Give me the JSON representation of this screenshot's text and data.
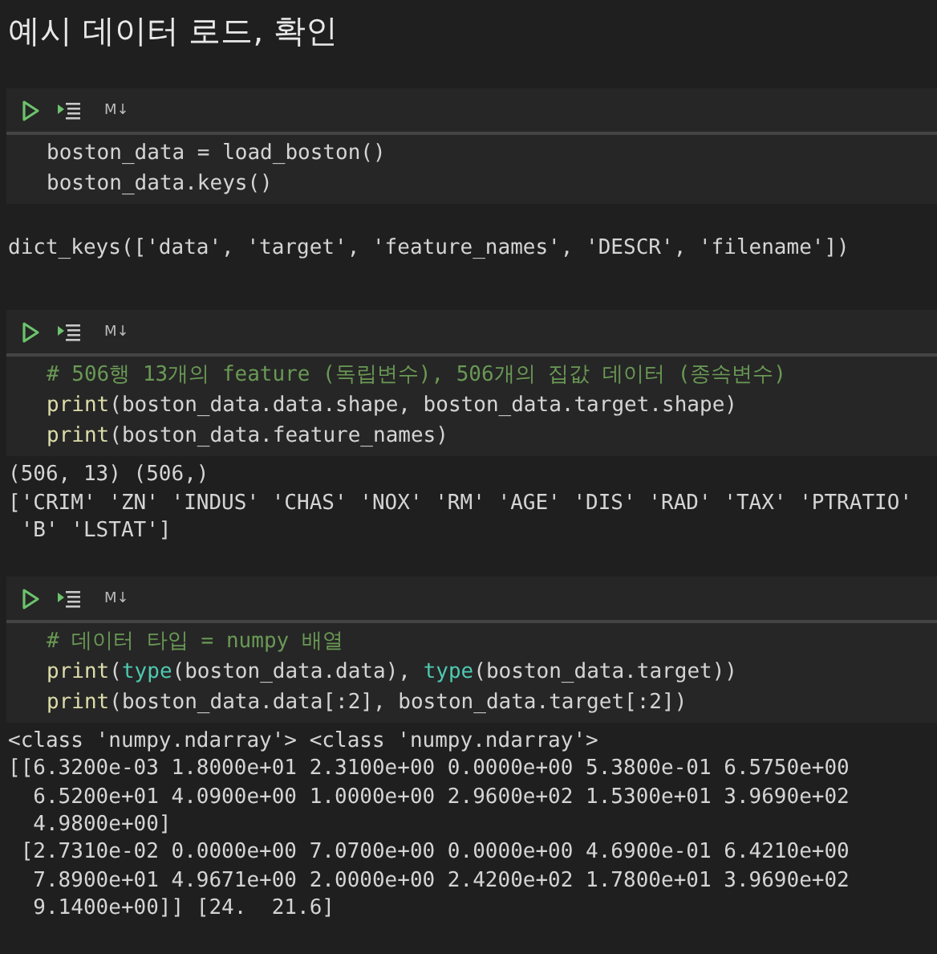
{
  "title": "예시 데이터 로드, 확인",
  "cells": [
    {
      "markdown_label": "M↓",
      "code": [
        [
          {
            "kind": "plain",
            "text": "boston_data = load_boston()"
          }
        ],
        [
          {
            "kind": "plain",
            "text": "boston_data.keys()"
          }
        ]
      ],
      "output": [
        "dict_keys(['data', 'target', 'feature_names', 'DESCR', 'filename'])"
      ]
    },
    {
      "markdown_label": "M↓",
      "code": [
        [
          {
            "kind": "comment",
            "text": "# 506행 13개의 feature (독립변수), 506개의 집값 데이터 (종속변수)"
          }
        ],
        [
          {
            "kind": "function",
            "text": "print"
          },
          {
            "kind": "plain",
            "text": "(boston_data.data.shape, boston_data.target.shape)"
          }
        ],
        [
          {
            "kind": "function",
            "text": "print"
          },
          {
            "kind": "plain",
            "text": "(boston_data.feature_names)"
          }
        ]
      ],
      "output": [
        "(506, 13) (506,)",
        "['CRIM' 'ZN' 'INDUS' 'CHAS' 'NOX' 'RM' 'AGE' 'DIS' 'RAD' 'TAX' 'PTRATIO'",
        " 'B' 'LSTAT']"
      ]
    },
    {
      "markdown_label": "M↓",
      "code": [
        [
          {
            "kind": "comment",
            "text": "# 데이터 타입 = numpy 배열"
          }
        ],
        [
          {
            "kind": "function",
            "text": "print"
          },
          {
            "kind": "plain",
            "text": "("
          },
          {
            "kind": "type",
            "text": "type"
          },
          {
            "kind": "plain",
            "text": "(boston_data.data), "
          },
          {
            "kind": "type",
            "text": "type"
          },
          {
            "kind": "plain",
            "text": "(boston_data.target))"
          }
        ],
        [
          {
            "kind": "function",
            "text": "print"
          },
          {
            "kind": "plain",
            "text": "(boston_data.data[:2], boston_data.target[:2])"
          }
        ]
      ],
      "output": [
        "<class 'numpy.ndarray'> <class 'numpy.ndarray'>",
        "[[6.3200e-03 1.8000e+01 2.3100e+00 0.0000e+00 5.3800e-01 6.5750e+00",
        "  6.5200e+01 4.0900e+00 1.0000e+00 2.9600e+02 1.5300e+01 3.9690e+02",
        "  4.9800e+00]",
        " [2.7310e-02 0.0000e+00 7.0700e+00 0.0000e+00 4.6900e-01 6.4210e+00",
        "  7.8900e+01 4.9671e+00 2.0000e+00 2.4200e+02 1.7800e+01 3.9690e+02",
        "  9.1400e+00]] [24.  21.6]"
      ]
    }
  ]
}
